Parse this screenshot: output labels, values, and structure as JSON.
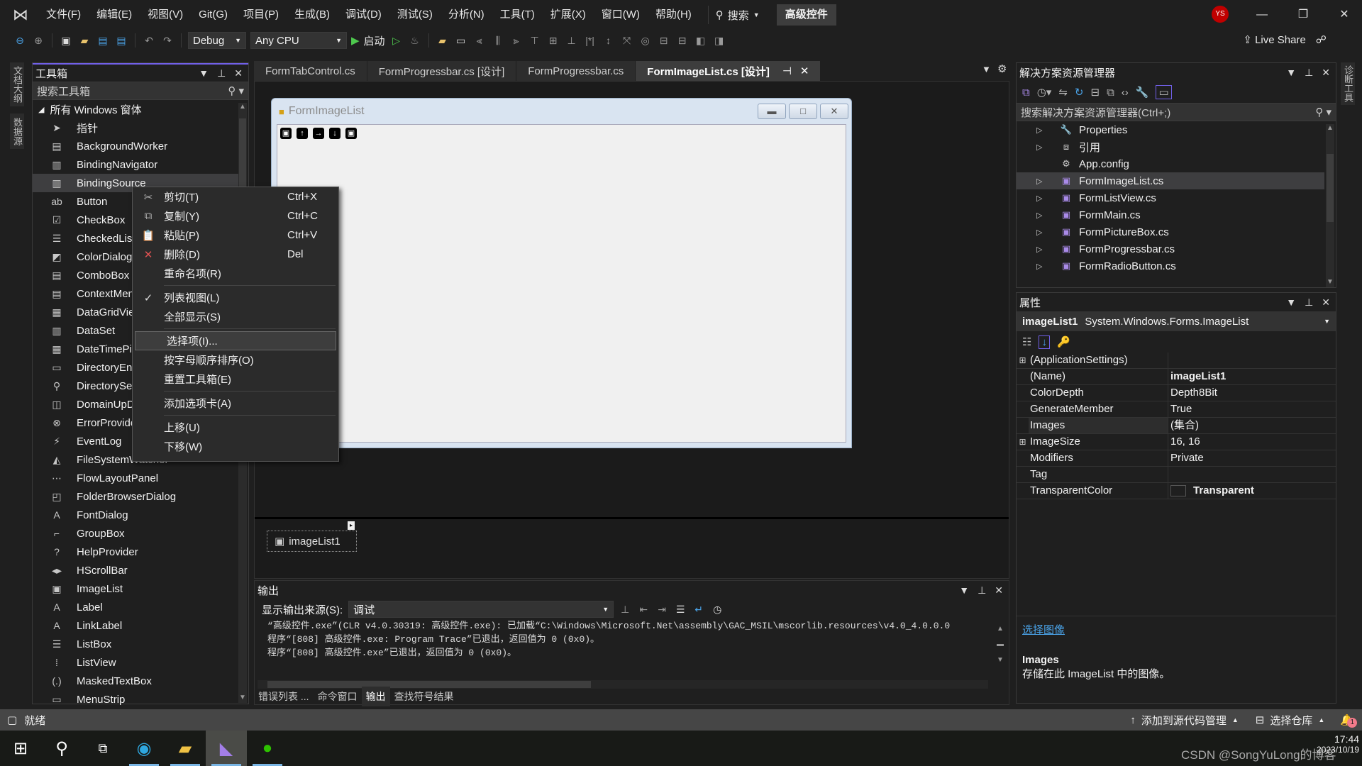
{
  "titlebar": {
    "menus": [
      "文件(F)",
      "编辑(E)",
      "视图(V)",
      "Git(G)",
      "项目(P)",
      "生成(B)",
      "调试(D)",
      "测试(S)",
      "分析(N)",
      "工具(T)",
      "扩展(X)",
      "窗口(W)",
      "帮助(H)"
    ],
    "search_label": "搜索",
    "solution_name": "高级控件",
    "avatar_initials": "YS"
  },
  "toolbar": {
    "configuration": "Debug",
    "platform": "Any CPU",
    "start_label": "启动",
    "live_share": "Live Share"
  },
  "side_tabs": {
    "left": [
      "文档大纲",
      "数据源"
    ],
    "right": [
      "诊断工具"
    ]
  },
  "toolbox": {
    "title": "工具箱",
    "search_placeholder": "搜索工具箱",
    "group": "所有 Windows 窗体",
    "items": [
      {
        "label": "指针",
        "icon": "pointer-icon"
      },
      {
        "label": "BackgroundWorker",
        "icon": "backgroundworker-icon"
      },
      {
        "label": "BindingNavigator",
        "icon": "bindingnavigator-icon"
      },
      {
        "label": "BindingSource",
        "icon": "bindingsource-icon",
        "selected": true
      },
      {
        "label": "Button",
        "icon": "button-icon"
      },
      {
        "label": "CheckBox",
        "icon": "checkbox-icon"
      },
      {
        "label": "CheckedListBox",
        "icon": "checkedlistbox-icon"
      },
      {
        "label": "ColorDialog",
        "icon": "colordialog-icon"
      },
      {
        "label": "ComboBox",
        "icon": "combobox-icon"
      },
      {
        "label": "ContextMenuStrip",
        "icon": "contextmenu-icon"
      },
      {
        "label": "DataGridView",
        "icon": "datagridview-icon"
      },
      {
        "label": "DataSet",
        "icon": "dataset-icon"
      },
      {
        "label": "DateTimePicker",
        "icon": "datetimepicker-icon"
      },
      {
        "label": "DirectoryEntry",
        "icon": "directoryentry-icon"
      },
      {
        "label": "DirectorySearcher",
        "icon": "directorysearcher-icon"
      },
      {
        "label": "DomainUpDown",
        "icon": "domainupdown-icon"
      },
      {
        "label": "ErrorProvider",
        "icon": "errorprovider-icon"
      },
      {
        "label": "EventLog",
        "icon": "eventlog-icon"
      },
      {
        "label": "FileSystemWatcher",
        "icon": "filesystemwatcher-icon"
      },
      {
        "label": "FlowLayoutPanel",
        "icon": "flowlayoutpanel-icon"
      },
      {
        "label": "FolderBrowserDialog",
        "icon": "folderbrowser-icon"
      },
      {
        "label": "FontDialog",
        "icon": "fontdialog-icon"
      },
      {
        "label": "GroupBox",
        "icon": "groupbox-icon"
      },
      {
        "label": "HelpProvider",
        "icon": "helpprovider-icon"
      },
      {
        "label": "HScrollBar",
        "icon": "hscrollbar-icon"
      },
      {
        "label": "ImageList",
        "icon": "imagelist-icon"
      },
      {
        "label": "Label",
        "icon": "label-icon"
      },
      {
        "label": "LinkLabel",
        "icon": "linklabel-icon"
      },
      {
        "label": "ListBox",
        "icon": "listbox-icon"
      },
      {
        "label": "ListView",
        "icon": "listview-icon"
      },
      {
        "label": "MaskedTextBox",
        "icon": "maskedtextbox-icon"
      },
      {
        "label": "MenuStrip",
        "icon": "menustrip-icon"
      }
    ]
  },
  "context_menu": {
    "items": [
      {
        "label": "剪切(T)",
        "shortcut": "Ctrl+X",
        "icon": "cut-icon"
      },
      {
        "label": "复制(Y)",
        "shortcut": "Ctrl+C",
        "icon": "copy-icon"
      },
      {
        "label": "粘贴(P)",
        "shortcut": "Ctrl+V",
        "icon": "paste-icon"
      },
      {
        "label": "删除(D)",
        "shortcut": "Del",
        "icon": "delete-icon"
      },
      {
        "label": "重命名项(R)"
      },
      {
        "sep": true
      },
      {
        "label": "列表视图(L)",
        "checked": true
      },
      {
        "label": "全部显示(S)"
      },
      {
        "sep": true
      },
      {
        "label": "选择项(I)...",
        "highlighted": true
      },
      {
        "label": "按字母顺序排序(O)"
      },
      {
        "label": "重置工具箱(E)"
      },
      {
        "sep": true
      },
      {
        "label": "添加选项卡(A)"
      },
      {
        "sep": true
      },
      {
        "label": "上移(U)"
      },
      {
        "label": "下移(W)"
      }
    ]
  },
  "doc_tabs": [
    {
      "label": "FormTabControl.cs"
    },
    {
      "label": "FormProgressbar.cs [设计]"
    },
    {
      "label": "FormProgressbar.cs"
    },
    {
      "label": "FormImageList.cs [设计]",
      "active": true
    }
  ],
  "designer": {
    "form_title": "FormImageList",
    "form_icons": [
      "save",
      "up",
      "right",
      "down",
      "image"
    ],
    "tray_component": "imageList1"
  },
  "output": {
    "title": "输出",
    "source_label": "显示输出来源(S):",
    "source_value": "调试",
    "lines": [
      "“高级控件.exe”(CLR v4.0.30319: 高级控件.exe): 已加载“C:\\Windows\\Microsoft.Net\\assembly\\GAC_MSIL\\mscorlib.resources\\v4.0_4.0.0.0",
      "程序“[808] 高级控件.exe: Program Trace”已退出，返回值为 0 (0x0)。",
      "程序“[808] 高级控件.exe”已退出，返回值为 0 (0x0)。"
    ],
    "bottom_tabs": [
      {
        "label": "错误列表 ..."
      },
      {
        "label": "命令窗口"
      },
      {
        "label": "输出",
        "active": true
      },
      {
        "label": "查找符号结果"
      }
    ]
  },
  "solution_explorer": {
    "title": "解决方案资源管理器",
    "search_placeholder": "搜索解决方案资源管理器(Ctrl+;)",
    "items": [
      {
        "label": "Properties",
        "icon": "wrench-icon",
        "expandable": true
      },
      {
        "label": "引用",
        "icon": "references-icon",
        "expandable": true
      },
      {
        "label": "App.config",
        "icon": "config-icon",
        "expandable": false
      },
      {
        "label": "FormImageList.cs",
        "icon": "form-icon",
        "expandable": true,
        "selected": true
      },
      {
        "label": "FormListView.cs",
        "icon": "form-icon",
        "expandable": true
      },
      {
        "label": "FormMain.cs",
        "icon": "form-icon",
        "expandable": true
      },
      {
        "label": "FormPictureBox.cs",
        "icon": "form-icon",
        "expandable": true
      },
      {
        "label": "FormProgressbar.cs",
        "icon": "form-icon",
        "expandable": true
      },
      {
        "label": "FormRadioButton.cs",
        "icon": "form-icon",
        "expandable": true
      }
    ]
  },
  "properties": {
    "title": "属性",
    "object_name": "imageList1",
    "object_type": "System.Windows.Forms.ImageList",
    "rows": [
      {
        "name": "(ApplicationSettings)",
        "value": "",
        "expandable": true
      },
      {
        "name": "(Name)",
        "value": "imageList1",
        "bold": true
      },
      {
        "name": "ColorDepth",
        "value": "Depth8Bit"
      },
      {
        "name": "GenerateMember",
        "value": "True"
      },
      {
        "name": "Images",
        "value": "(集合)",
        "selected": true
      },
      {
        "name": "ImageSize",
        "value": "16, 16",
        "expandable": true
      },
      {
        "name": "Modifiers",
        "value": "Private"
      },
      {
        "name": "Tag",
        "value": ""
      },
      {
        "name": "TransparentColor",
        "value": "Transparent",
        "bold": true,
        "swatch": "#1f1f1f"
      }
    ],
    "action_link": "选择图像",
    "desc_title": "Images",
    "desc_text": "存储在此 ImageList 中的图像。"
  },
  "status": {
    "text": "就绪",
    "source_control": "添加到源代码管理",
    "repo": "选择仓库",
    "notifications": "1"
  },
  "taskbar": {
    "time": "17:44",
    "date": "2023/10/19",
    "watermark": "CSDN @SongYuLong的博客"
  },
  "colors": {
    "accent": "#7160e8",
    "link": "#4aa3e8",
    "avatar": "#c00000",
    "start": "#4ec94e"
  }
}
